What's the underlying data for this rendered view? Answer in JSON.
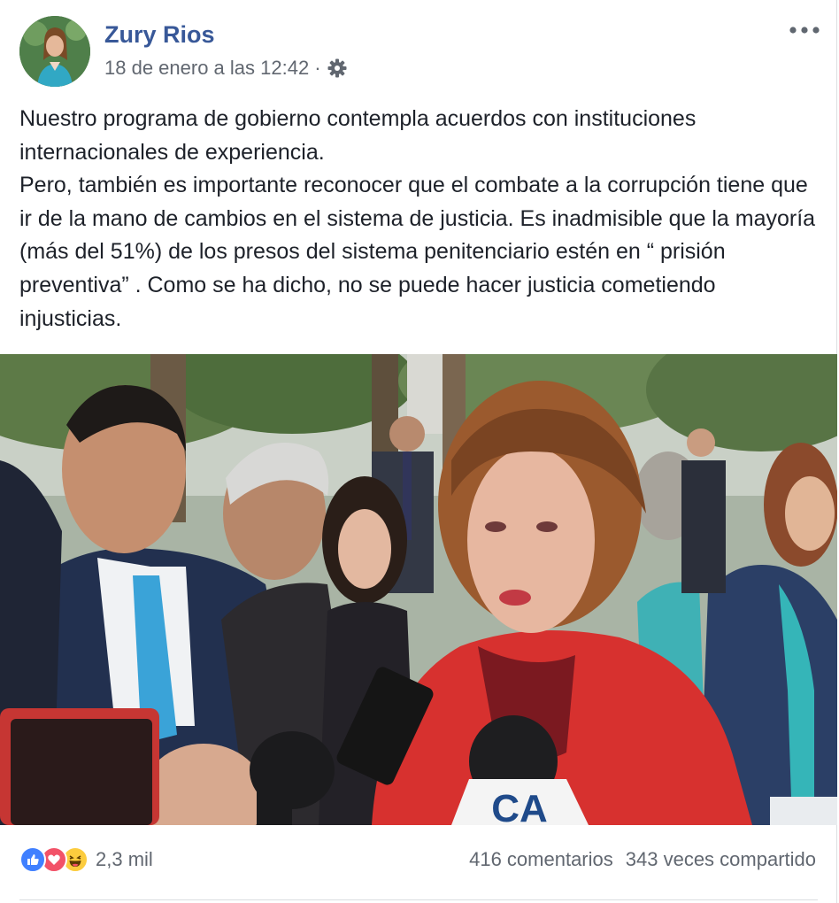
{
  "post": {
    "author": "Zury Rios",
    "timestamp": "18 de enero a las 12:42",
    "separator": "·",
    "privacy_icon": "gear-icon",
    "more_icon": "more-options-icon",
    "message": {
      "paragraph_1": "Nuestro programa de gobierno contempla acuerdos con instituciones internacionales de experiencia.",
      "paragraph_2": "Pero, también es importante reconocer que el combate a la corrupción tiene que ir de la mano de cambios en el sistema de justicia. Es inadmisible que la mayoría (más del 51%) de los presos del sistema penitenciario estén en “ prisión preventiva” . Como se ha dicho, no se puede hacer justicia cometiendo injusticias."
    },
    "photo": {
      "microphone_logo": "CA"
    }
  },
  "footer": {
    "reaction_icons": [
      "like-icon",
      "love-icon",
      "haha-icon"
    ],
    "reaction_count": "2,3 mil",
    "comments": "416 comentarios",
    "shares": "343 veces compartido"
  },
  "colors": {
    "author_link": "#385898",
    "meta_text": "#616770",
    "like": "#4080ff",
    "love": "#f25268",
    "haha": "#fccc3e"
  }
}
